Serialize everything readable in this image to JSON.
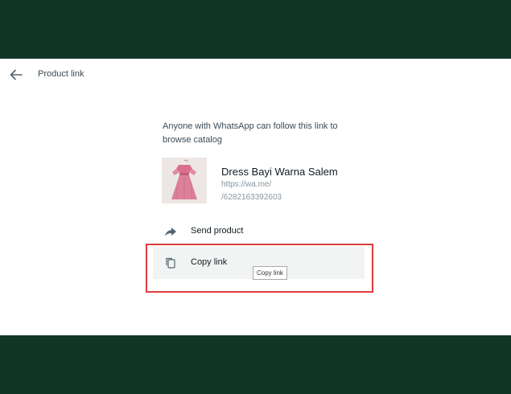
{
  "header": {
    "title": "Product link",
    "back_icon": "arrow-left-icon"
  },
  "description": "Anyone with WhatsApp can follow this link to browse catalog",
  "product": {
    "name": "Dress Bayi Warna Salem",
    "url_line1": "https://wa.me/",
    "url_line2": "/6282163392603",
    "thumbnail_icon": "pink-dress-photo"
  },
  "actions": {
    "send_label": "Send product",
    "send_icon": "share-arrow-icon",
    "copy_label": "Copy link",
    "copy_icon": "copy-icon"
  },
  "tooltip": "Copy link",
  "colors": {
    "background": "#113527",
    "panel": "#ffffff",
    "highlight": "#dc3c3c",
    "text_secondary": "#8696a0"
  }
}
